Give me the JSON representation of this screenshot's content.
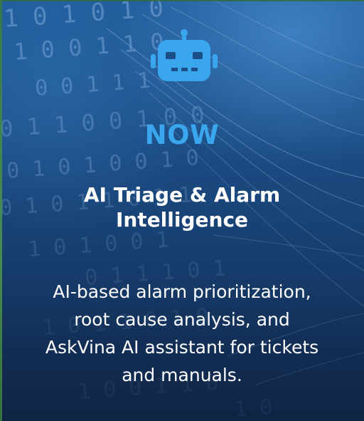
{
  "robot_icon": {
    "name": "robot-icon",
    "color": "#3aa6ee"
  },
  "stage_label": "NOW",
  "title_lines": [
    "AI Triage & Alarm",
    "Intelligence"
  ],
  "description_lines": [
    "AI-based alarm prioritization,",
    "root cause analysis, and",
    "AskVina AI assistant for tickets",
    "and manuals."
  ],
  "colors": {
    "accent": "#3aa6ee",
    "text": "#ffffff",
    "background_top": "#1f5a98",
    "background_bottom": "#0f2444"
  }
}
